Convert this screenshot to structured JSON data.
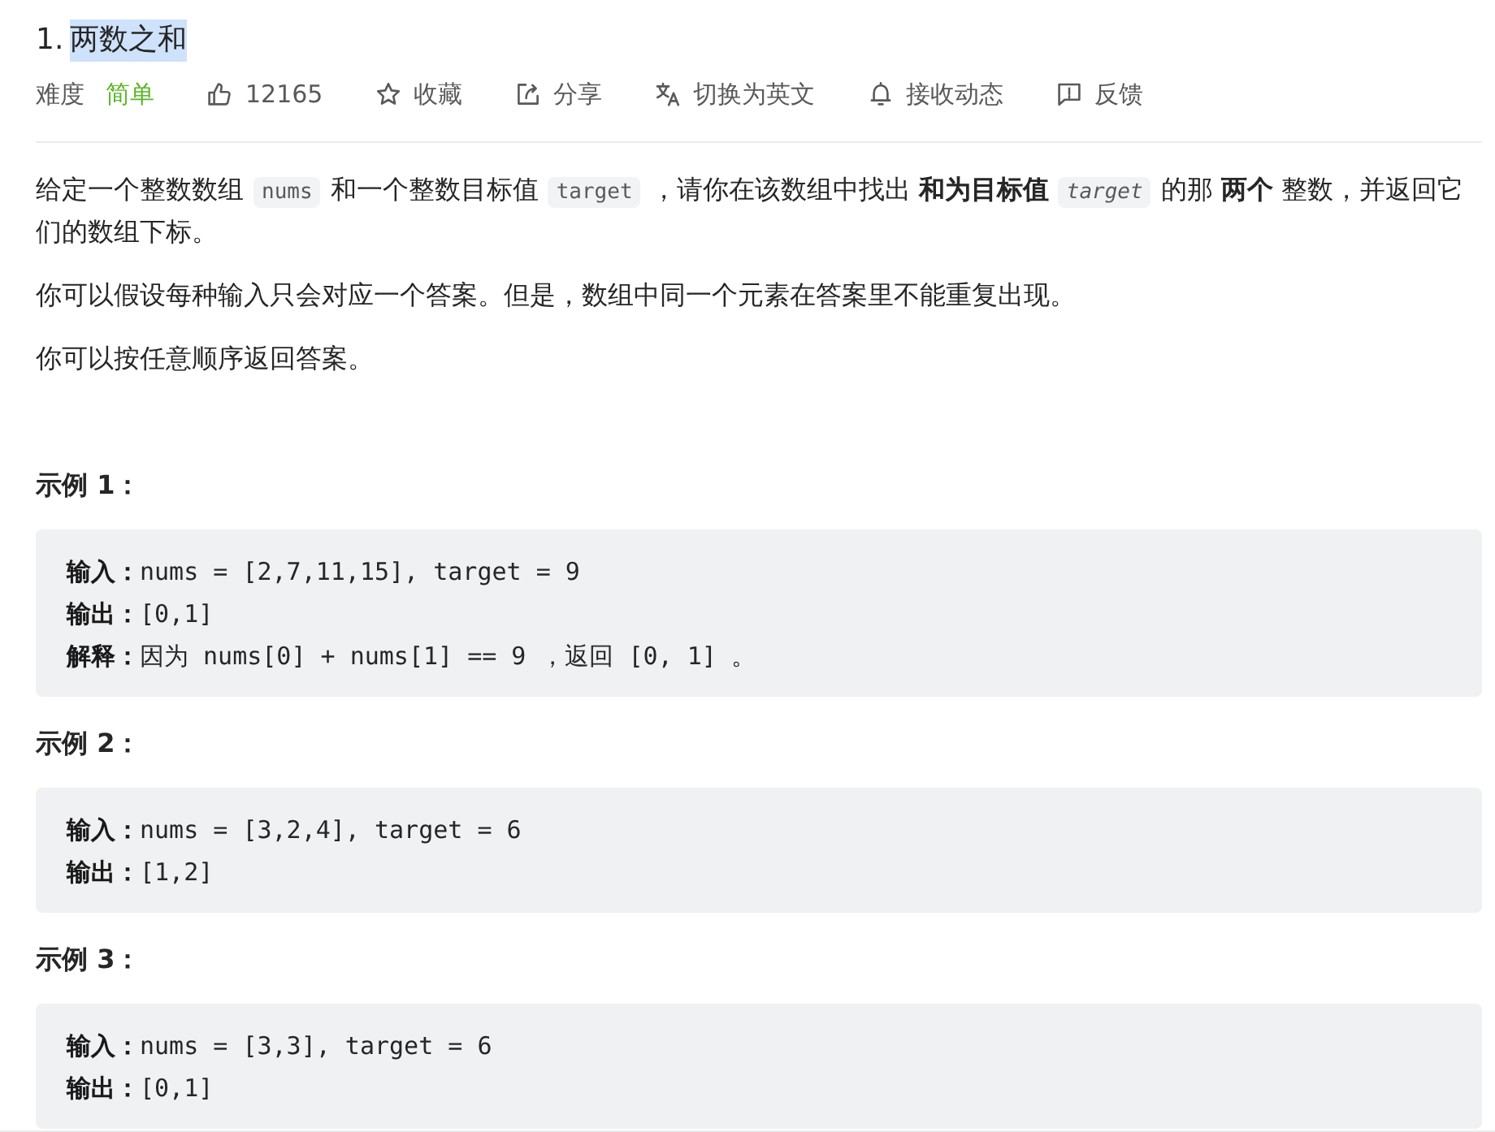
{
  "title": {
    "number": "1.",
    "name": "两数之和",
    "highlighted": true
  },
  "meta": {
    "difficulty": {
      "label": "难度",
      "value": "简单",
      "kind": "easy"
    },
    "actions": [
      {
        "kind": "like",
        "label": "12165"
      },
      {
        "kind": "favorite",
        "label": "收藏"
      },
      {
        "kind": "share",
        "label": "分享"
      },
      {
        "kind": "translate",
        "label": "切换为英文"
      },
      {
        "kind": "subscribe",
        "label": "接收动态"
      },
      {
        "kind": "feedback",
        "label": "反馈"
      }
    ]
  },
  "description": [
    {
      "segments": [
        {
          "kind": "text",
          "text": "给定一个整数数组"
        },
        {
          "kind": "code",
          "text": "nums"
        },
        {
          "kind": "text",
          "text": "和一个整数目标值"
        },
        {
          "kind": "code",
          "text": "target"
        },
        {
          "kind": "text",
          "text": "，请你在该数组中找出 **和为目标值**"
        },
        {
          "kind": "var",
          "text": "target"
        },
        {
          "kind": "text",
          "text": "的那 **两个** 整数，并返回它们的数组下标。"
        }
      ]
    },
    {
      "segments": [
        {
          "kind": "text",
          "text": "你可以假设每种输入只会对应一个答案。但是，数组中同一个元素在答案里不能重复出现。"
        }
      ]
    },
    {
      "segments": [
        {
          "kind": "text",
          "text": "你可以按任意顺序返回答案。"
        }
      ]
    }
  ],
  "examples": [
    {
      "title": "示例 1：",
      "lines": [
        {
          "label": "输入：",
          "text": "nums = [2,7,11,15], target = 9"
        },
        {
          "label": "输出：",
          "text": "[0,1]"
        },
        {
          "label": "解释：",
          "text": "因为 nums[0] + nums[1] == 9 ，返回 [0, 1] 。"
        }
      ]
    },
    {
      "title": "示例 2：",
      "lines": [
        {
          "label": "输入：",
          "text": "nums = [3,2,4], target = 6"
        },
        {
          "label": "输出：",
          "text": "[1,2]"
        }
      ]
    },
    {
      "title": "示例 3：",
      "lines": [
        {
          "label": "输入：",
          "text": "nums = [3,3], target = 6"
        },
        {
          "label": "输出：",
          "text": "[0,1]"
        }
      ]
    }
  ]
}
